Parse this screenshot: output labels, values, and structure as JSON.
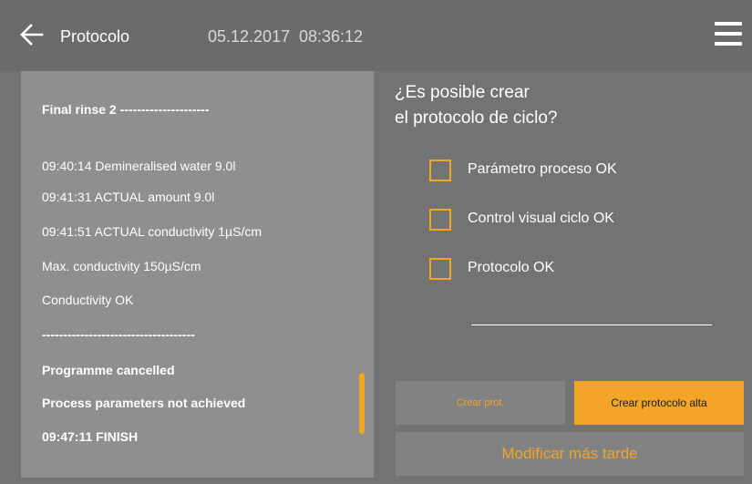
{
  "header": {
    "title": "Protocolo",
    "date": "05.12.2017",
    "time": "08:36:12",
    "back_icon": "arrow-left-icon",
    "menu_icon": "hamburger-menu-icon"
  },
  "log": {
    "lines": [
      {
        "text": "Final rinse 2 ---------------------",
        "bold": true
      },
      {
        "text": "09:40:14 Demineralised water 9.0l",
        "bold": false
      },
      {
        "text": "09:41:31 ACTUAL amount 9.0l",
        "bold": false
      },
      {
        "text": "09:41:51 ACTUAL conductivity 1µS/cm",
        "bold": false
      },
      {
        "text": "Max. conductivity 150µS/cm",
        "bold": false
      },
      {
        "text": "Conductivity OK",
        "bold": false
      },
      {
        "text": "------------------------------------",
        "bold": true
      },
      {
        "text": "Programme cancelled",
        "bold": true
      },
      {
        "text": "Process parameters not achieved",
        "bold": true
      },
      {
        "text": "09:47:11 FINISH",
        "bold": true
      }
    ]
  },
  "question": {
    "line1": "¿Es posible crear",
    "line2": "el protocolo de ciclo?"
  },
  "checklist": [
    {
      "label": "Parámetro proceso OK",
      "checked": false
    },
    {
      "label": "Control visual ciclo OK",
      "checked": false
    },
    {
      "label": "Protocolo OK",
      "checked": false
    }
  ],
  "buttons": {
    "crear_prot": "Crear prot.",
    "crear_alta": "Crear protocolo alta",
    "modificar": "Modificar más tarde"
  },
  "colors": {
    "accent": "#f2a527",
    "background": "#737373",
    "panel": "#8f8f8f",
    "button_disabled": "#828282"
  }
}
